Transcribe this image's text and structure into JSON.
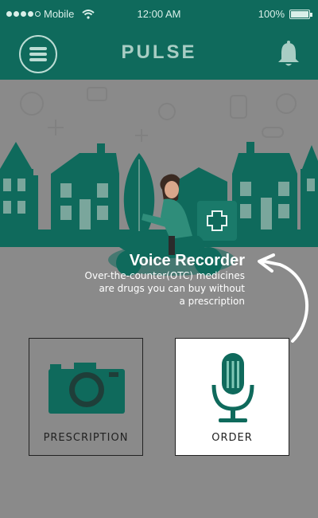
{
  "status_bar": {
    "carrier": "Mobile",
    "time": "12:00 AM",
    "battery": "100%"
  },
  "header": {
    "title": "PULSE"
  },
  "tooltip": {
    "title": "Voice Recorder",
    "body_line1": "Over-the-counter(OTC) medicines",
    "body_line2": "are drugs you can buy without",
    "body_line3": "a prescription"
  },
  "cards": {
    "prescription_label": "PRESCRIPTION",
    "order_label": "ORDER"
  },
  "colors": {
    "brand": "#0f6a5c",
    "overlay": "#8a8a8a",
    "card_highlight": "#ffffff"
  },
  "icons": {
    "menu": "hamburger-menu-icon",
    "notifications": "bell-icon",
    "prescription": "camera-icon",
    "order": "microphone-icon"
  }
}
